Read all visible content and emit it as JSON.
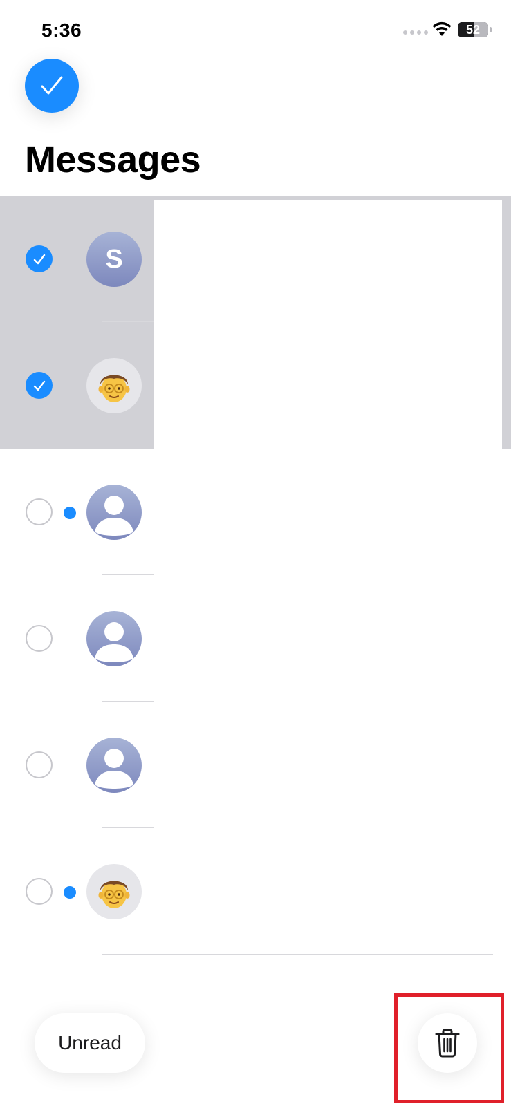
{
  "status_bar": {
    "time": "5:36",
    "battery_level": "52",
    "battery_percent": 52
  },
  "header": {
    "title": "Messages"
  },
  "conversations": [
    {
      "selected": true,
      "unread": false,
      "avatar_type": "letter",
      "avatar_letter": "S"
    },
    {
      "selected": true,
      "unread": false,
      "avatar_type": "memoji"
    },
    {
      "selected": false,
      "unread": true,
      "avatar_type": "placeholder"
    },
    {
      "selected": false,
      "unread": false,
      "avatar_type": "placeholder"
    },
    {
      "selected": false,
      "unread": false,
      "avatar_type": "placeholder"
    },
    {
      "selected": false,
      "unread": true,
      "avatar_type": "memoji"
    }
  ],
  "toolbar": {
    "unread_label": "Unread",
    "delete_icon": "trash-icon"
  },
  "colors": {
    "accent": "#1a8cff",
    "selected_row": "#d1d1d6",
    "highlight": "#e0202a"
  }
}
